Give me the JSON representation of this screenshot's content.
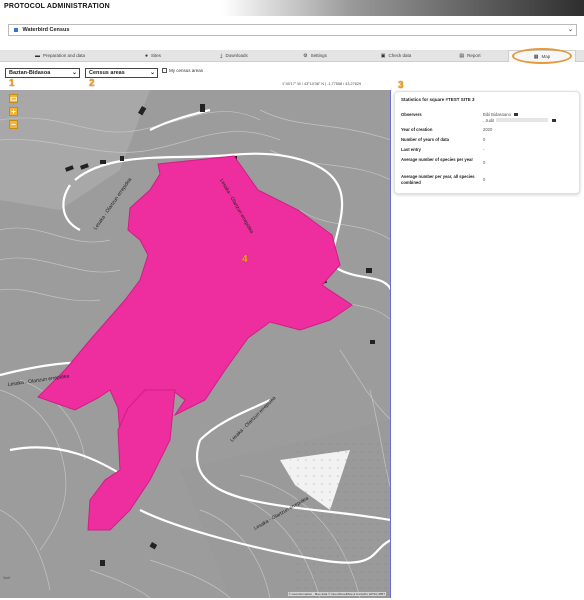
{
  "header": {
    "title": "PROTOCOL ADMINISTRATION"
  },
  "protocol_selector": {
    "value": "Waterbird Census"
  },
  "tabs": [
    {
      "label": "Preparation and data",
      "icon": "folder-icon"
    },
    {
      "label": "Sites",
      "icon": "pin-icon"
    },
    {
      "label": "Downloads",
      "icon": "download-icon"
    },
    {
      "label": "Settings",
      "icon": "gear-icon"
    },
    {
      "label": "Check data",
      "icon": "check-icon"
    },
    {
      "label": "Report",
      "icon": "report-icon"
    },
    {
      "label": "Map",
      "icon": "map-icon",
      "active": true
    }
  ],
  "map_controls": {
    "layer_select": "Baztan-Bidasoa",
    "area_select": "Census areas",
    "checkbox_label": "My census areas"
  },
  "annotations": {
    "n1": "1",
    "n2": "2",
    "n3": "3",
    "n4": "4"
  },
  "coordinates": "1°40'17\" W / 43°10'36\" N | -1,77558 / 43,27629",
  "map": {
    "road_labels": [
      "Lesaka - Olartzun errepidea",
      "Lesaka - Olartzun errepidea",
      "Lesaka - Olartzun errepidea",
      "Lesaka - Olartzun errepidea",
      "Lesaka - Olartzun errepidea"
    ],
    "attribution": "© Geoinformation · Map data © OpenStreetMap & Cartodb | EPSG:3857",
    "polygon_color": "#ee2d9f"
  },
  "stats": {
    "title": "Statistics for square #TEST SITE 3",
    "observers_label": "Observers",
    "observer_1": "Bibi Bidasoano",
    "observer_2": ", Judit",
    "year_label": "Year of creation",
    "year_value": "2020",
    "years_data_label": "Number of years of data",
    "years_data_value": "0",
    "last_entry_label": "Last entry",
    "last_entry_value": "-",
    "avg_label": "Average number of species per year",
    "avg_value": "0",
    "avg_all_label": "Average number per year, all species combined",
    "avg_all_value": "0"
  }
}
